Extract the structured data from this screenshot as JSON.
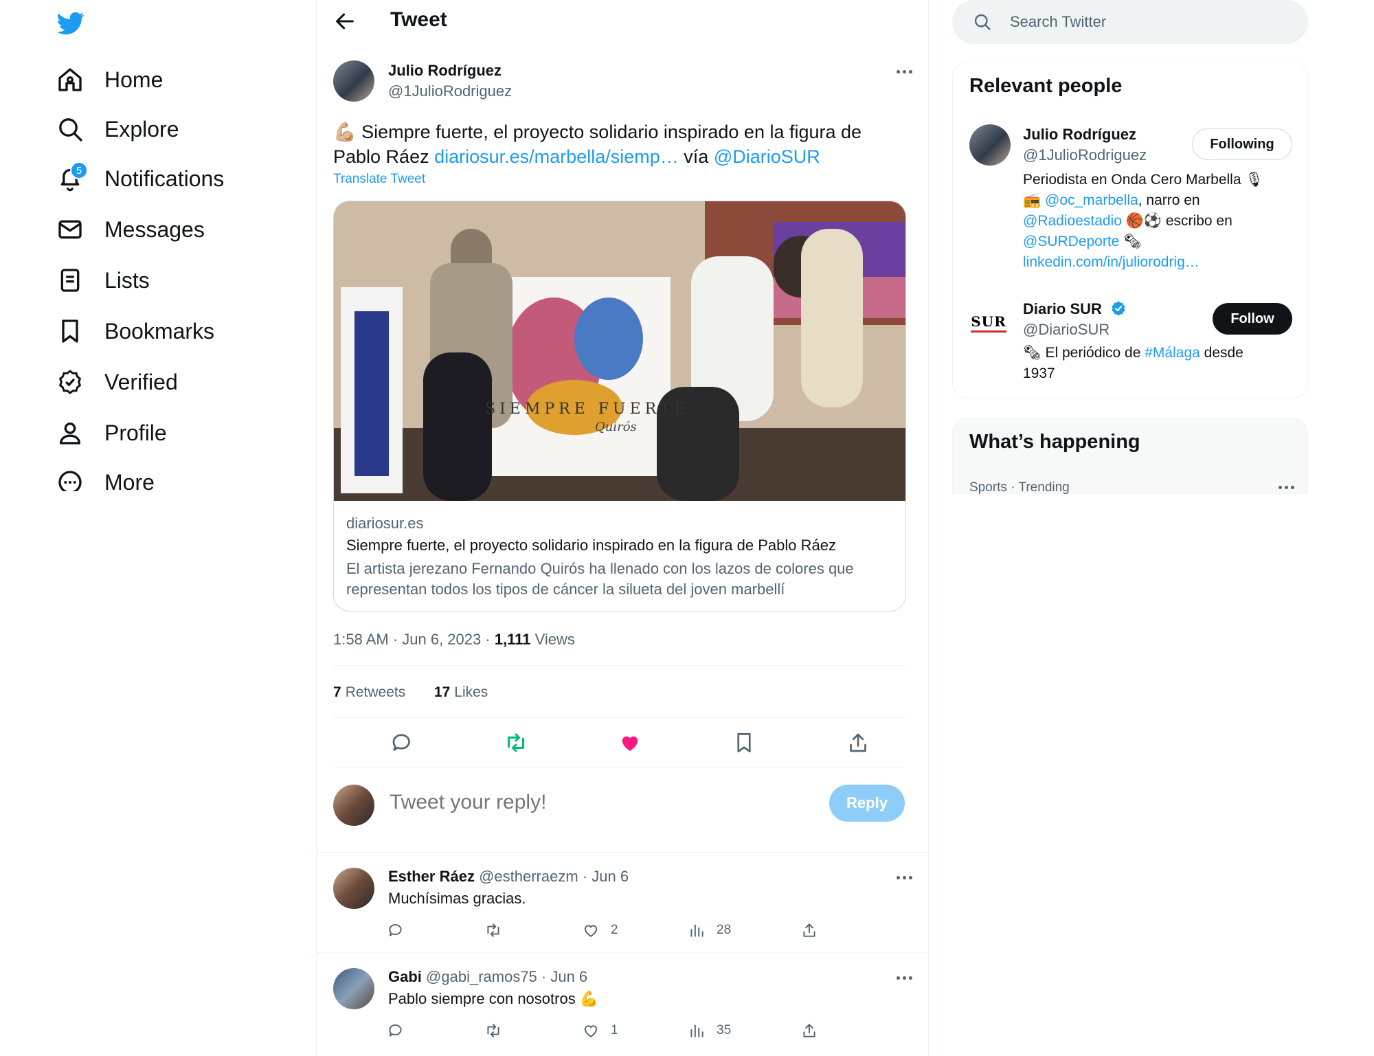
{
  "nav": {
    "items": [
      {
        "label": "Home"
      },
      {
        "label": "Explore"
      },
      {
        "label": "Notifications",
        "badge": "5"
      },
      {
        "label": "Messages"
      },
      {
        "label": "Lists"
      },
      {
        "label": "Bookmarks"
      },
      {
        "label": "Verified"
      },
      {
        "label": "Profile"
      },
      {
        "label": "More"
      }
    ]
  },
  "header": {
    "title": "Tweet"
  },
  "tweet": {
    "author_name": "Julio Rodríguez",
    "author_handle": "@1JulioRodriguez",
    "emoji": "💪🏼",
    "text_part1": "Siempre fuerte, el proyecto solidario inspirado en la figura de Pablo Ráez",
    "link_text": "diariosur.es/marbella/siemp…",
    "via_text": "vía",
    "mention": "@DiarioSUR",
    "translate_label": "Translate Tweet",
    "card": {
      "image_text": "SIEMPRE FUERTE",
      "image_signature": "Quirós",
      "domain": "diariosur.es",
      "title": "Siempre fuerte, el proyecto solidario inspirado en la figura de Pablo Ráez",
      "description": "El artista jerezano Fernando Quirós ha llenado con los lazos de colores que representan todos los tipos de cáncer la silueta del joven marbellí"
    },
    "time": "1:58 AM · Jun 6, 2023 · ",
    "views_count": "1,111",
    "views_label": "Views",
    "retweets_count": "7",
    "retweets_label": "Retweets",
    "likes_count": "17",
    "likes_label": "Likes"
  },
  "reply_box": {
    "placeholder": "Tweet your reply!",
    "button_label": "Reply"
  },
  "replies": [
    {
      "name": "Esther Ráez",
      "handle_date": "@estherraezm · Jun 6",
      "text": "Muchísimas gracias.",
      "likes": "2",
      "views": "28"
    },
    {
      "name": "Gabi",
      "handle_date": "@gabi_ramos75 · Jun 6",
      "text": "Pablo siempre con nosotros 💪",
      "likes": "1",
      "views": "35"
    }
  ],
  "search": {
    "placeholder": "Search Twitter"
  },
  "relevant": {
    "title": "Relevant people",
    "people": [
      {
        "name": "Julio Rodríguez",
        "handle": "@1JulioRodriguez",
        "button": "Following",
        "bio_1": "Periodista en Onda Cero Marbella 🎙",
        "bio_2_emoji": "📻",
        "bio_2_mention": "@oc_marbella",
        "bio_2_rest": ", narro en",
        "bio_3_mention": "@Radioestadio",
        "bio_3_rest": " 🏀⚽ escribo en",
        "bio_4_mention": "@SURDeporte",
        "bio_4_rest": " 🗞",
        "bio_5_link": "linkedin.com/in/juliorodrig…"
      },
      {
        "name": "Diario SUR",
        "handle": "@DiarioSUR",
        "button": "Follow",
        "logo_text": "SUR",
        "bio_1_pre": "🗞 El periódico de ",
        "bio_1_tag": "#Málaga",
        "bio_1_post": " desde",
        "bio_2": "1937"
      }
    ]
  },
  "happening": {
    "title": "What’s happening",
    "item_meta": "Sports · Trending"
  },
  "colors": {
    "accent": "#1d9bf0",
    "like": "#f91880",
    "retweet": "#00ba7c"
  }
}
